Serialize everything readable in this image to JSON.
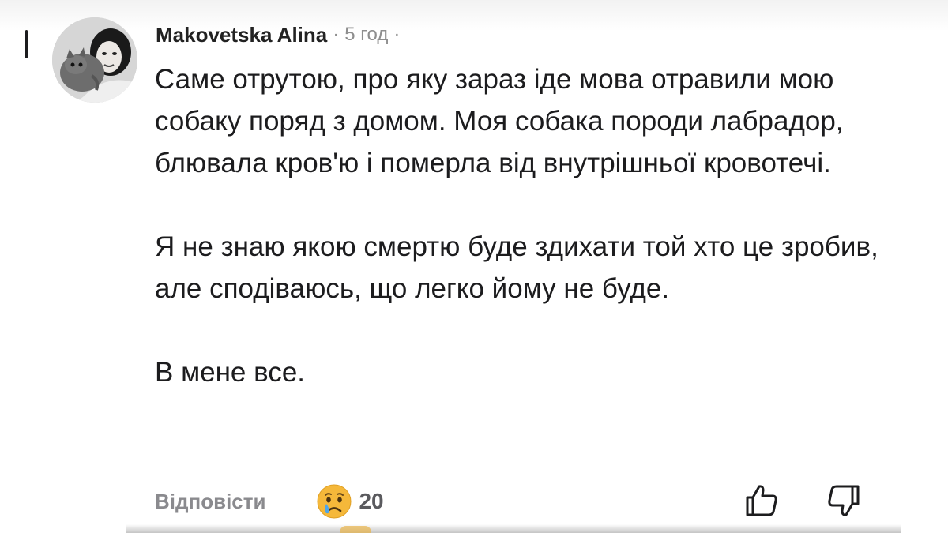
{
  "comment": {
    "author": "Makovetska Alina",
    "separator": "·",
    "time": "5 год",
    "trailing_separator": "·",
    "paragraphs": [
      "Саме отрутою, про яку зараз іде мова отравили мою собаку поряд з домом. Моя собака породи лабрадор, блювала кров'ю і померла від внутрішньої кровотечі.",
      "Я не знаю якою смертю буде здихати той хто це зробив, але сподіваюсь, що легко йому не буде.",
      "В мене все."
    ],
    "reply_label": "Відповісти",
    "reaction": {
      "icon": "sad-tear-emoji-icon",
      "count": "20"
    }
  },
  "icons": {
    "like": "thumbs-up-icon",
    "dislike": "thumbs-down-icon"
  },
  "colors": {
    "text": "#1c1c1e",
    "meta": "#8e8e8e",
    "reply": "#8a8a8e",
    "emoji": "#f5b83a"
  }
}
